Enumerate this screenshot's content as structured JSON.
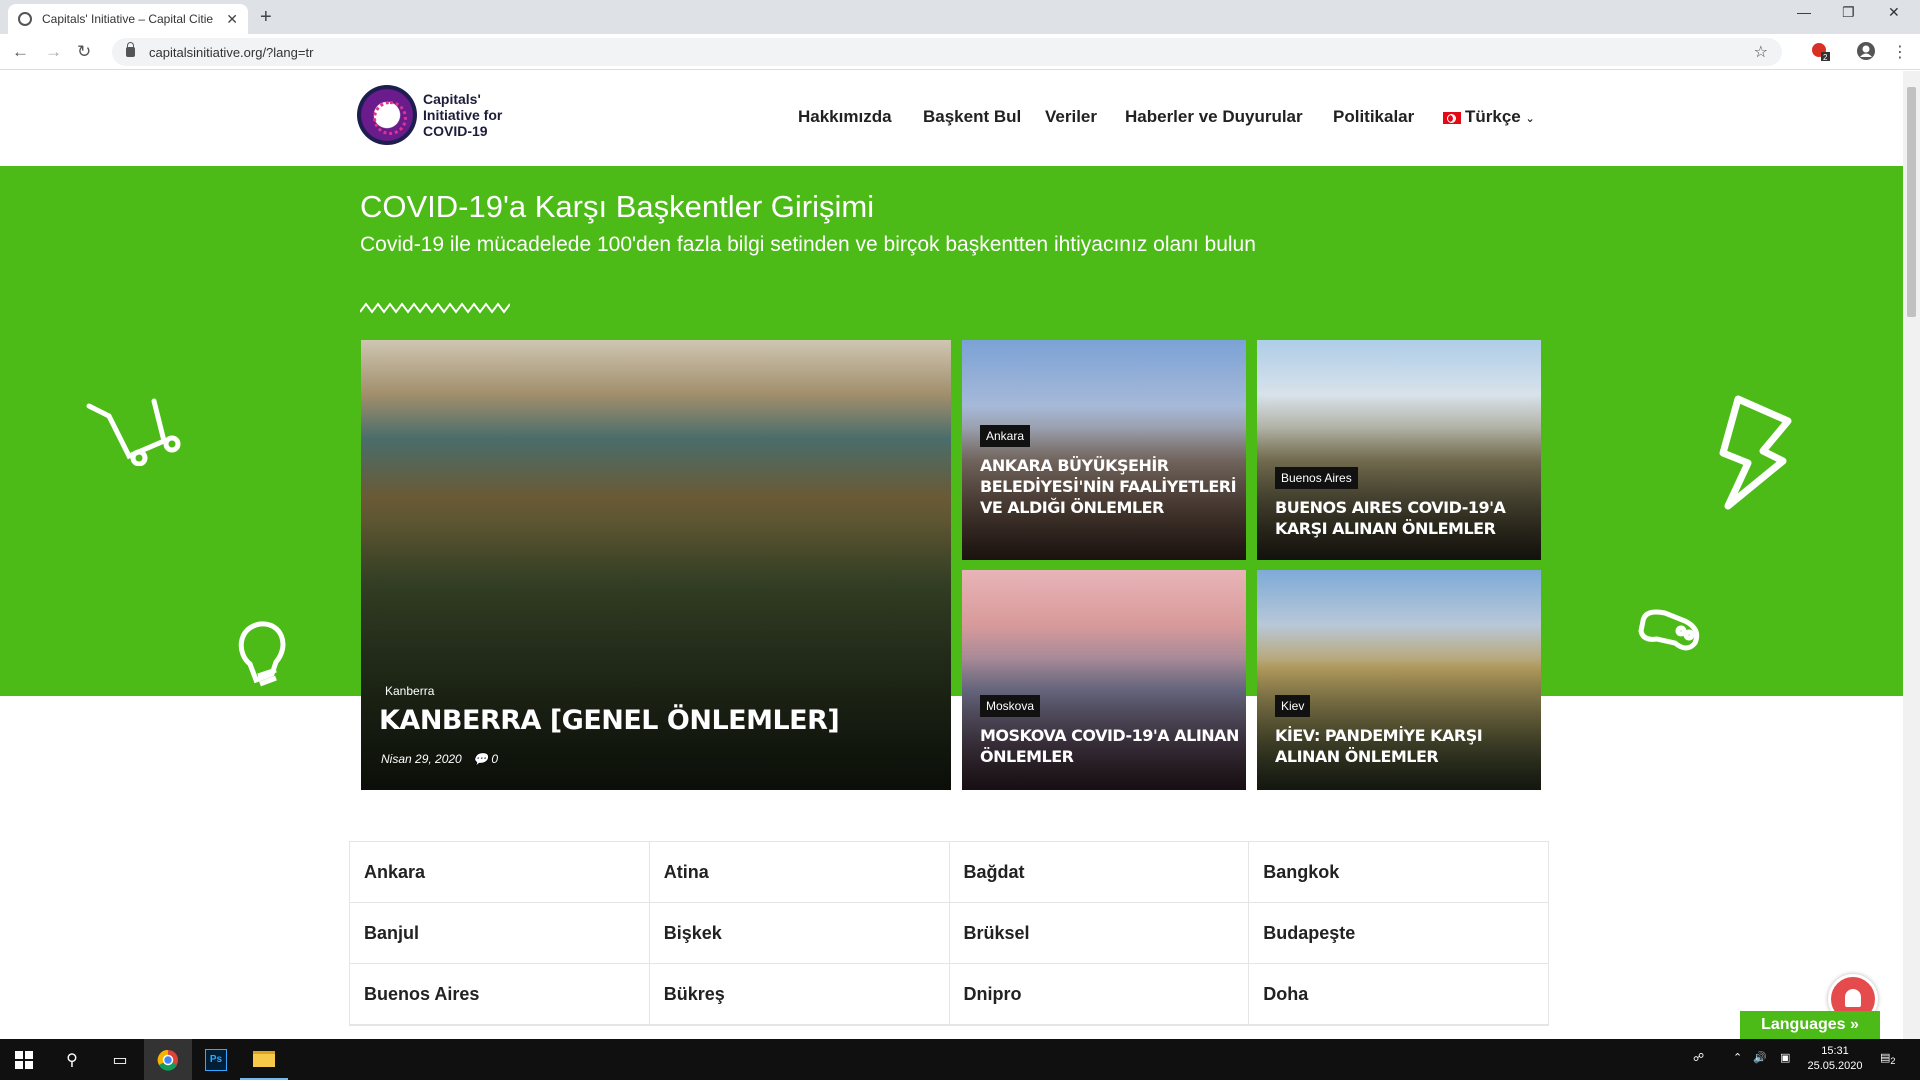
{
  "browser": {
    "tab_title": "Capitals' Initiative – Capital Citie",
    "url": "capitalsinitiative.org/?lang=tr",
    "extension_badge": "2"
  },
  "header": {
    "logo_text_line1": "Capitals'",
    "logo_text_line2": "Initiative for",
    "logo_text_line3": "COVID-19",
    "menu": [
      "Hakkımızda",
      "Başkent Bul",
      "Veriler",
      "Haberler ve Duyurular",
      "Politikalar"
    ],
    "language": "Türkçe"
  },
  "hero": {
    "title": "COVID-19'a Karşı Başkentler Girişimi",
    "subtitle": "Covid-19 ile mücadelede 100'den fazla bilgi setinden ve birçok başkentten ihtiyacınız olanı bulun",
    "cards": [
      {
        "category": "Kanberra",
        "title": "KANBERRA [GENEL ÖNLEMLER]",
        "date": "Nisan 29, 2020",
        "comments": "0"
      },
      {
        "category": "Ankara",
        "title": "ANKARA BÜYÜKŞEHİR BELEDİYESİ'NİN FAALİYETLERİ VE ALDIĞI ÖNLEMLER"
      },
      {
        "category": "Buenos Aires",
        "title": "BUENOS AIRES COVID-19'A KARŞI ALINAN ÖNLEMLER"
      },
      {
        "category": "Moskova",
        "title": "MOSKOVA COVID-19'A ALINAN ÖNLEMLER"
      },
      {
        "category": "Kiev",
        "title": "KİEV: PANDEMİYE KARŞI ALINAN ÖNLEMLER"
      }
    ]
  },
  "cities": [
    [
      "Ankara",
      "Atina",
      "Bağdat",
      "Bangkok"
    ],
    [
      "Banjul",
      "Bişkek",
      "Brüksel",
      "Budapeşte"
    ],
    [
      "Buenos Aires",
      "Bükreş",
      "Dnipro",
      "Doha"
    ]
  ],
  "languages_button": "Languages »",
  "taskbar": {
    "time": "15:31",
    "date": "25.05.2020",
    "notification_count": "2"
  }
}
